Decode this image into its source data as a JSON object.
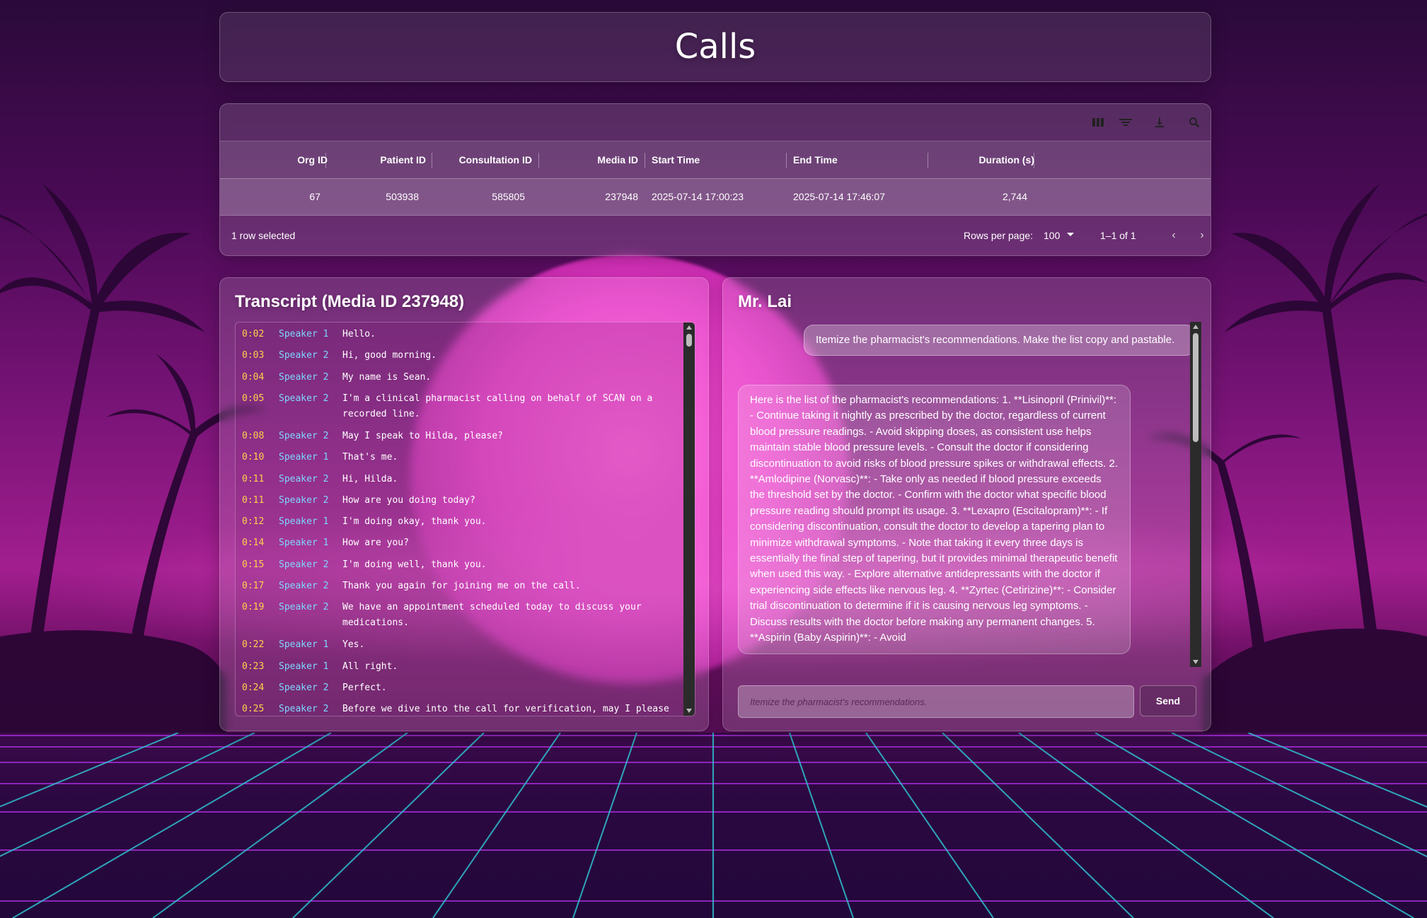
{
  "page": {
    "title": "Calls"
  },
  "grid": {
    "toolbar": [
      "columns-icon",
      "filter-icon",
      "download-icon",
      "search-icon"
    ],
    "columns": [
      "Org ID",
      "Patient ID",
      "Consultation ID",
      "Media ID",
      "Start Time",
      "End Time",
      "Duration (s)"
    ],
    "rows": [
      [
        "67",
        "503938",
        "585805",
        "237948",
        "2025-07-14 17:00:23",
        "2025-07-14 17:46:07",
        "2,744"
      ]
    ],
    "footer": {
      "selected": "1 row selected",
      "rows_per_page_label": "Rows per page:",
      "rows_per_page_value": "100",
      "range": "1–1 of 1"
    }
  },
  "transcript": {
    "title": "Transcript (Media ID 237948)",
    "lines": [
      {
        "time": "0:02",
        "speaker": "Speaker 1",
        "text": "Hello."
      },
      {
        "time": "0:03",
        "speaker": "Speaker 2",
        "text": "Hi, good morning."
      },
      {
        "time": "0:04",
        "speaker": "Speaker 2",
        "text": "My name is Sean."
      },
      {
        "time": "0:05",
        "speaker": "Speaker 2",
        "text": "I'm a clinical pharmacist calling on behalf of SCAN on a recorded line."
      },
      {
        "time": "0:08",
        "speaker": "Speaker 2",
        "text": "May I speak to Hilda, please?"
      },
      {
        "time": "0:10",
        "speaker": "Speaker 1",
        "text": "That's me."
      },
      {
        "time": "0:11",
        "speaker": "Speaker 2",
        "text": "Hi, Hilda."
      },
      {
        "time": "0:11",
        "speaker": "Speaker 2",
        "text": "How are you doing today?"
      },
      {
        "time": "0:12",
        "speaker": "Speaker 1",
        "text": "I'm doing okay, thank you."
      },
      {
        "time": "0:14",
        "speaker": "Speaker 1",
        "text": "How are you?"
      },
      {
        "time": "0:15",
        "speaker": "Speaker 2",
        "text": "I'm doing well, thank you."
      },
      {
        "time": "0:17",
        "speaker": "Speaker 2",
        "text": "Thank you again for joining me on the call."
      },
      {
        "time": "0:19",
        "speaker": "Speaker 2",
        "text": "We have an appointment scheduled today to discuss your medications."
      },
      {
        "time": "0:22",
        "speaker": "Speaker 1",
        "text": "Yes."
      },
      {
        "time": "0:23",
        "speaker": "Speaker 1",
        "text": "All right."
      },
      {
        "time": "0:24",
        "speaker": "Speaker 2",
        "text": "Perfect."
      },
      {
        "time": "0:25",
        "speaker": "Speaker 2",
        "text": "Before we dive into the call for verification, may I please"
      }
    ]
  },
  "chat": {
    "title": "Mr. Lai",
    "user_message": "Itemize the pharmacist's recommendations. Make the list copy and pastable.",
    "bot_message": "Here is the list of the pharmacist's recommendations: 1. **Lisinopril (Prinivil)**: - Continue taking it nightly as prescribed by the doctor, regardless of current blood pressure readings. - Avoid skipping doses, as consistent use helps maintain stable blood pressure levels. - Consult the doctor if considering discontinuation to avoid risks of blood pressure spikes or withdrawal effects. 2. **Amlodipine (Norvasc)**: - Take only as needed if blood pressure exceeds the threshold set by the doctor. - Confirm with the doctor what specific blood pressure reading should prompt its usage. 3. **Lexapro (Escitalopram)**: - If considering discontinuation, consult the doctor to develop a tapering plan to minimize withdrawal symptoms. - Note that taking it every three days is essentially the final step of tapering, but it provides minimal therapeutic benefit when used this way. - Explore alternative antidepressants with the doctor if experiencing side effects like nervous leg. 4. **Zyrtec (Cetirizine)**: - Consider trial discontinuation to determine if it is causing nervous leg symptoms. - Discuss results with the doctor before making any permanent changes. 5. **Aspirin (Baby Aspirin)**: - Avoid",
    "input_placeholder": "Itemize the pharmacist's recommendations.",
    "send_label": "Send"
  }
}
